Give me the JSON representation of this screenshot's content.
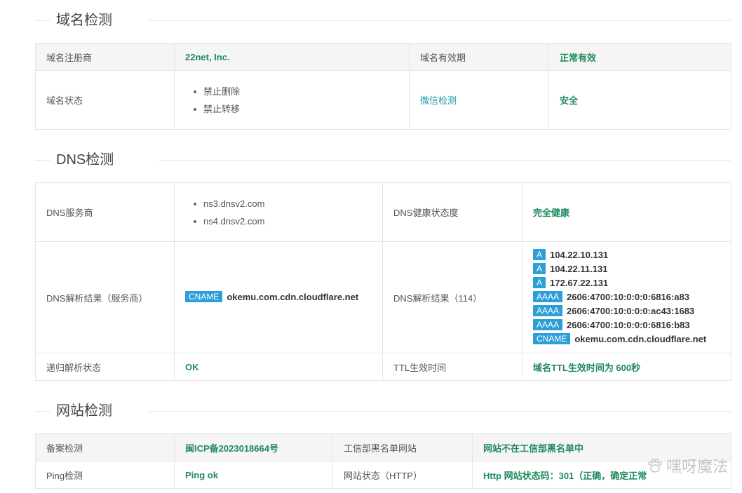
{
  "sections": {
    "domain": "域名检测",
    "dns": "DNS检测",
    "site": "网站检测"
  },
  "domain_table": {
    "registrar_label": "域名注册商",
    "registrar_value": "22net, Inc.",
    "validity_label": "域名有效期",
    "validity_value": "正常有效",
    "status_label": "域名状态",
    "status_items": [
      "禁止删除",
      "禁止转移"
    ],
    "wechat_label": "微信检测",
    "wechat_value": "安全"
  },
  "dns_table": {
    "provider_label": "DNS服务商",
    "ns_items": [
      "ns3.dnsv2.com",
      "ns4.dnsv2.com"
    ],
    "health_label": "DNS健康状态度",
    "health_value": "完全健康",
    "result_provider_label": "DNS解析结果（服务商）",
    "result_provider": {
      "tag": "CNAME",
      "value": "okemu.com.cdn.cloudflare.net"
    },
    "result_114_label": "DNS解析结果（114）",
    "records_114": [
      {
        "tag": "A",
        "value": "104.22.10.131"
      },
      {
        "tag": "A",
        "value": "104.22.11.131"
      },
      {
        "tag": "A",
        "value": "172.67.22.131"
      },
      {
        "tag": "AAAA",
        "value": "2606:4700:10:0:0:0:6816:a83"
      },
      {
        "tag": "AAAA",
        "value": "2606:4700:10:0:0:0:ac43:1683"
      },
      {
        "tag": "AAAA",
        "value": "2606:4700:10:0:0:0:6816:b83"
      },
      {
        "tag": "CNAME",
        "value": "okemu.com.cdn.cloudflare.net"
      }
    ],
    "recursive_label": "递归解析状态",
    "recursive_value": "OK",
    "ttl_label": "TTL生效时间",
    "ttl_value": "域名TTL生效时间为 600秒"
  },
  "site_table": {
    "icp_label": "备案检测",
    "icp_value": "闽ICP备2023018664号",
    "blacklist_label": "工信部黑名单网站",
    "blacklist_value": "网站不在工信部黑名单中",
    "ping_label": "Ping检测",
    "ping_value": "Ping ok",
    "http_label": "网站状态（HTTP）",
    "http_value": "Http 网站状态码：301（正确，确定正常"
  },
  "watermark": "嘿呀魔法"
}
